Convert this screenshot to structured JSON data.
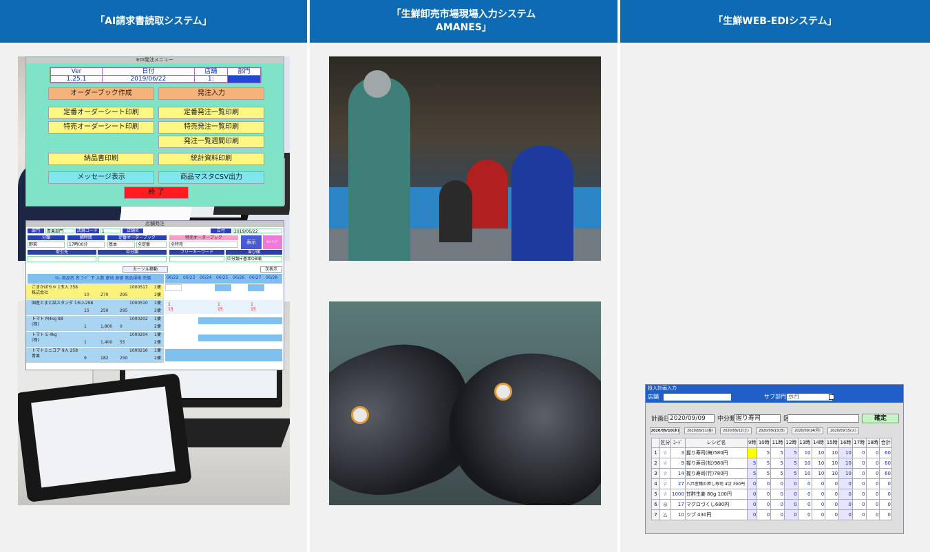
{
  "columns": [
    {
      "title_line1": "「AI請求書読取システム」",
      "title_line2": ""
    },
    {
      "title_line1": "「生鮮卸売市場現場入力システム",
      "title_line2": "AMANES」"
    },
    {
      "title_line1": "「生鮮WEB-EDIシステム」",
      "title_line2": ""
    }
  ],
  "colors": {
    "header_blue": "#0d6ab3",
    "panel_bg": "#f1f1f1"
  },
  "edi_menu": {
    "window_title": "EDI発注メニュー",
    "hdr_labels": [
      "Ver",
      "日付",
      "店舗",
      "部門"
    ],
    "hdr_values": [
      "1.25.1",
      "2019/06/22",
      "1:",
      ""
    ],
    "buttons": [
      "オーダーブック作成",
      "発注入力",
      "定番オーダーシート印刷",
      "定番発注一覧印刷",
      "特売オーダーシート印刷",
      "特売発注一覧印刷",
      "発注一覧週間印刷",
      "納品書印刷",
      "統計資料印刷",
      "メッセージ表示",
      "商品マスタCSV出力",
      "終 了"
    ]
  },
  "order_list": {
    "window_title": "店舗発注",
    "top_labels": [
      "部門",
      "青果部門",
      "店舗コード",
      "1",
      "店舗名",
      "日付",
      "2019/06/22"
    ],
    "filter_labels": [
      "分類",
      "締時間",
      "定番オーダーブック",
      "特売オーダーブック",
      "表示",
      "ｾｯﾄｱｯﾌﾟ"
    ],
    "filter_values": [
      "野菜",
      "17時00分",
      "基本",
      "全定番",
      "全特売"
    ],
    "filter2_labels": [
      "取引先",
      "中分類",
      "フリーキーワード",
      "並び順"
    ],
    "sort_value": "中分類+基本OB順",
    "cursor_label": "カーソル移動",
    "next_label": "次表示",
    "col_header": "ｾﾙ: 商品名 名 ｺｰﾄﾞ 下 入数 産地 原価 商品規格 売価",
    "dates": [
      "06/22",
      "06/23",
      "06/24",
      "06/25",
      "06/26",
      "06/27",
      "06/28"
    ],
    "items": [
      {
        "name": "ごまかぼちゃ 1玉入 358",
        "sub": "株式会社",
        "code": "1000517",
        "n1": "10",
        "n2": "270",
        "n3": "295"
      },
      {
        "name": "国産とまと詰スタンダ 1玉入298",
        "sub": "",
        "code": "1000510",
        "n1": "15",
        "n2": "250",
        "n3": "295"
      },
      {
        "name": "トマト M4kg 88",
        "sub": "(株)",
        "code": "1000202",
        "n1": "1",
        "n2": "1,800",
        "n3": "0"
      },
      {
        "name": "トマト S 4kg",
        "sub": "(株)",
        "code": "1000204",
        "n1": "1",
        "n2": "1,400",
        "n3": "55"
      },
      {
        "name": "トマトミニコア 9入 258",
        "sub": "青果",
        "code": "1000216",
        "n1": "9",
        "n2": "182",
        "n3": "250"
      }
    ],
    "bin_labels": [
      "1便",
      "2便"
    ],
    "counts": [
      "1",
      "15"
    ]
  },
  "input_grid": {
    "window_title": "投入計画入力",
    "store_label": "店舗",
    "sub_dept_label": "サブ部門",
    "sub_dept_value": "寿司",
    "store_filter_label": "店舗絞込み",
    "plan_date_label": "計画日",
    "plan_date_value": "2020/09/09",
    "mid_class_label": "中分類",
    "mid_class_value": "握り寿司",
    "kubun_label": "区分",
    "confirm_label": "確定",
    "date_tabs": [
      "2020/09/10(木)",
      "2020/09/11(金)",
      "2020/09/12(土)",
      "2020/09/13(日)",
      "2020/09/14(月)",
      "2020/09/15(火)"
    ],
    "headers": [
      "区分",
      "ｺｰﾄﾞ",
      "レシピ名",
      "9時",
      "10時",
      "11時",
      "12時",
      "13時",
      "14時",
      "15時",
      "16時",
      "17時",
      "18時",
      "合計"
    ],
    "rows": [
      {
        "no": "1",
        "kubun": "☆",
        "code": "3",
        "name": "握り寿司(梅)580円",
        "vals": [
          "",
          "5",
          "5",
          "5",
          "10",
          "10",
          "10",
          "10",
          "0",
          "0",
          "60"
        ]
      },
      {
        "no": "2",
        "kubun": "☆",
        "code": "9",
        "name": "握り寿司(松)980円",
        "vals": [
          "5",
          "5",
          "5",
          "5",
          "10",
          "10",
          "10",
          "10",
          "0",
          "0",
          "60"
        ]
      },
      {
        "no": "3",
        "kubun": "☆",
        "code": "14",
        "name": "握り寿司(竹)780円",
        "vals": [
          "5",
          "5",
          "5",
          "5",
          "10",
          "10",
          "10",
          "10",
          "0",
          "0",
          "60"
        ]
      },
      {
        "no": "4",
        "kubun": "☆",
        "code": "27",
        "name": "八戸産鯖の押し寿司 4切 390円",
        "vals": [
          "0",
          "0",
          "0",
          "0",
          "0",
          "0",
          "0",
          "0",
          "0",
          "0",
          "0"
        ]
      },
      {
        "no": "5",
        "kubun": "☆",
        "code": "1000",
        "name": "甘酢生姜 80g 100円",
        "vals": [
          "0",
          "0",
          "0",
          "0",
          "0",
          "0",
          "0",
          "0",
          "0",
          "0",
          "0"
        ]
      },
      {
        "no": "6",
        "kubun": "◎",
        "code": "17",
        "name": "マグロづくし680円",
        "vals": [
          "0",
          "0",
          "0",
          "0",
          "0",
          "0",
          "0",
          "0",
          "0",
          "0",
          "0"
        ]
      },
      {
        "no": "7",
        "kubun": "△",
        "code": "10",
        "name": "ツブ 430円",
        "vals": [
          "0",
          "0",
          "0",
          "0",
          "0",
          "0",
          "0",
          "0",
          "0",
          "0",
          "0"
        ]
      }
    ]
  }
}
